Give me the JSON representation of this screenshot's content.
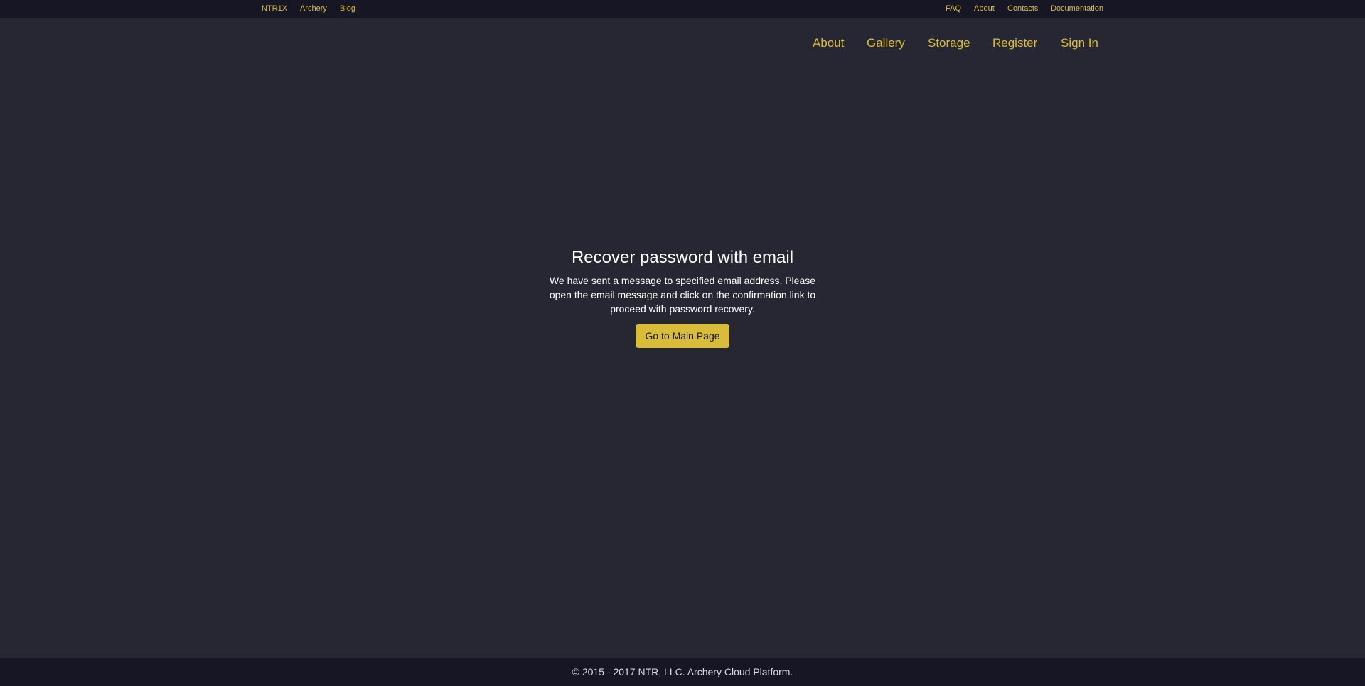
{
  "topbar": {
    "left": [
      "NTR1X",
      "Archery",
      "Blog"
    ],
    "right": [
      "FAQ",
      "About",
      "Contacts",
      "Documentation"
    ]
  },
  "nav": [
    "About",
    "Gallery",
    "Storage",
    "Register",
    "Sign In"
  ],
  "main": {
    "title": "Recover password with email",
    "message": "We have sent a message to specified email address. Please open the email message and click on the confirmation link to proceed with password recovery.",
    "button": "Go to Main Page"
  },
  "footer": {
    "text": "© 2015 - 2017 NTR, LLC. Archery Cloud Platform."
  },
  "colors": {
    "background": "#272734",
    "bar": "#161624",
    "accent": "#d9bd3a"
  }
}
